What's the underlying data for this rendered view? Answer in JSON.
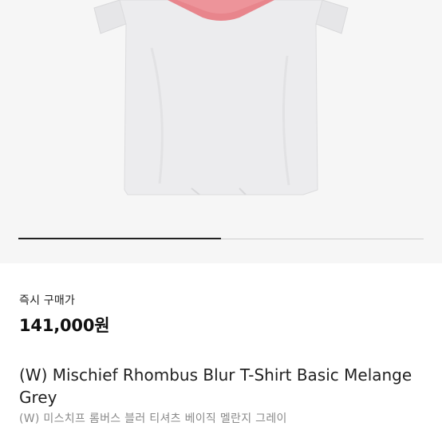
{
  "product": {
    "image_icon": "tshirt-image",
    "image_progress": 0.5,
    "price_label": "즉시 구매가",
    "price": "141,000원",
    "name_en": "(W) Mischief Rhombus Blur T-Shirt Basic Melange Grey",
    "name_ko": "(W) 미스치프 롬버스 블러 티셔츠 베이직 멜란지 그레이"
  },
  "colors": {
    "shirt": "#ececee",
    "graphic": "#e87f86",
    "text_primary": "#222222",
    "text_secondary": "#8a8a8a"
  }
}
